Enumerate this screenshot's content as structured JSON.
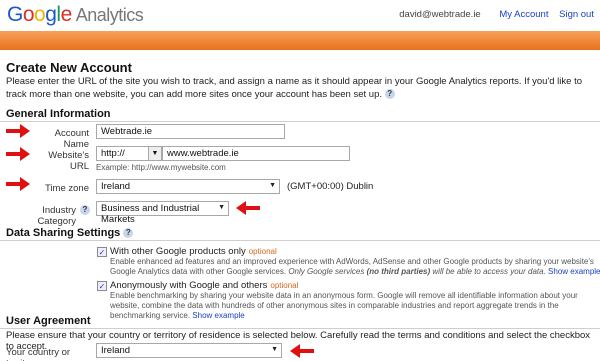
{
  "header": {
    "logo_google": [
      "G",
      "o",
      "o",
      "g",
      "l",
      "e"
    ],
    "logo_product": "Analytics",
    "user_email": "david@webtrade.ie",
    "my_account": "My Account",
    "sign_out": "Sign out",
    "accent": "#e8711c"
  },
  "page": {
    "title": "Create New Account",
    "intro": "Please enter the URL of the site you wish to track, and assign a name as it should appear in your Google Analytics reports. If you'd like to track more than one website, you can add more sites once your account has been set up."
  },
  "general": {
    "heading": "General Information",
    "account_name_label": "Account Name",
    "account_name_value": "Webtrade.ie",
    "website_url_label": "Website's URL",
    "protocol_value": "http://",
    "url_value": "www.webtrade.ie",
    "url_example": "Example: http://www.mywebsite.com",
    "time_zone_label": "Time zone",
    "time_zone_country": "Ireland",
    "time_zone_value": "(GMT+00:00) Dublin",
    "industry_label": "Industry Category",
    "industry_value": "Business and Industrial Markets"
  },
  "sharing": {
    "heading": "Data Sharing Settings",
    "option1_title": "With other Google products only",
    "option1_optional": "optional",
    "option1_desc_a": "Enable enhanced ad features and an improved experience with AdWords, AdSense and other Google products by sharing your website's Google Analytics data with other Google services.",
    "option1_desc_b": "Only Google services",
    "option1_desc_c": "(no third parties)",
    "option1_desc_d": "will be able to access your data.",
    "option1_link": "Show example",
    "option2_title": "Anonymously with Google and others",
    "option2_optional": "optional",
    "option2_desc": "Enable benchmarking by sharing your website data in an anonymous form. Google will remove all identifiable information about your website, combine the data with hundreds of other anonymous sites in comparable industries and report aggregate trends in the benchmarking service.",
    "option2_link": "Show example",
    "checkmark": "✓"
  },
  "agreement": {
    "heading": "User Agreement",
    "text": "Please ensure that your country or territory of residence is selected below. Carefully read the terms and conditions and select the checkbox to accept.",
    "country_label": "Your country or territory",
    "country_value": "Ireland"
  },
  "icons": {
    "help": "?",
    "dropdown": "▼"
  }
}
